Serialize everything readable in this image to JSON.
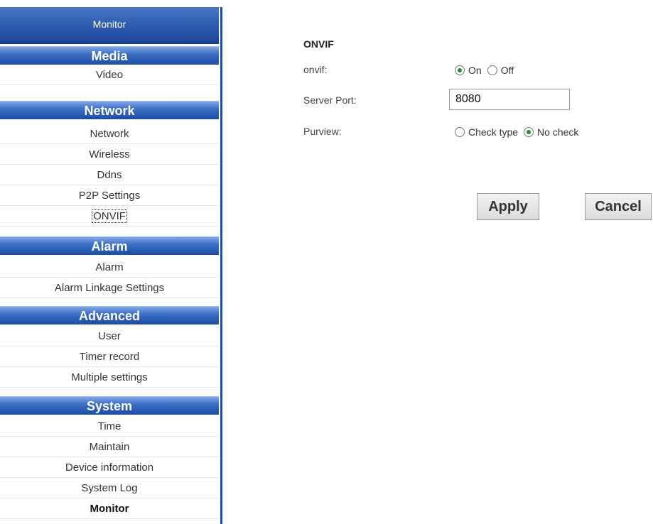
{
  "sidebar": {
    "header": "Monitor",
    "sections": [
      {
        "title": "Media",
        "items": [
          "Video"
        ]
      },
      {
        "title": "Network",
        "items": [
          "Network",
          "Wireless",
          "Ddns",
          "P2P Settings",
          "ONVIF"
        ]
      },
      {
        "title": "Alarm",
        "items": [
          "Alarm",
          "Alarm Linkage Settings"
        ]
      },
      {
        "title": "Advanced",
        "items": [
          "User",
          "Timer record",
          "Multiple settings"
        ]
      },
      {
        "title": "System",
        "items": [
          "Time",
          "Maintain",
          "Device information",
          "System Log",
          "Monitor"
        ]
      }
    ],
    "active_item": "ONVIF"
  },
  "main": {
    "title": "ONVIF",
    "onvif": {
      "label": "onvif:",
      "options": [
        "On",
        "Off"
      ],
      "selected": "On"
    },
    "server_port": {
      "label": "Server Port:",
      "value": "8080"
    },
    "purview": {
      "label": "Purview:",
      "options": [
        "Check type",
        "No check"
      ],
      "selected": "No check"
    },
    "buttons": {
      "apply": "Apply",
      "cancel": "Cancel"
    }
  },
  "colors": {
    "sidebar_blue": "#1f4ea5",
    "radio_checked": "#2d8a2d"
  }
}
